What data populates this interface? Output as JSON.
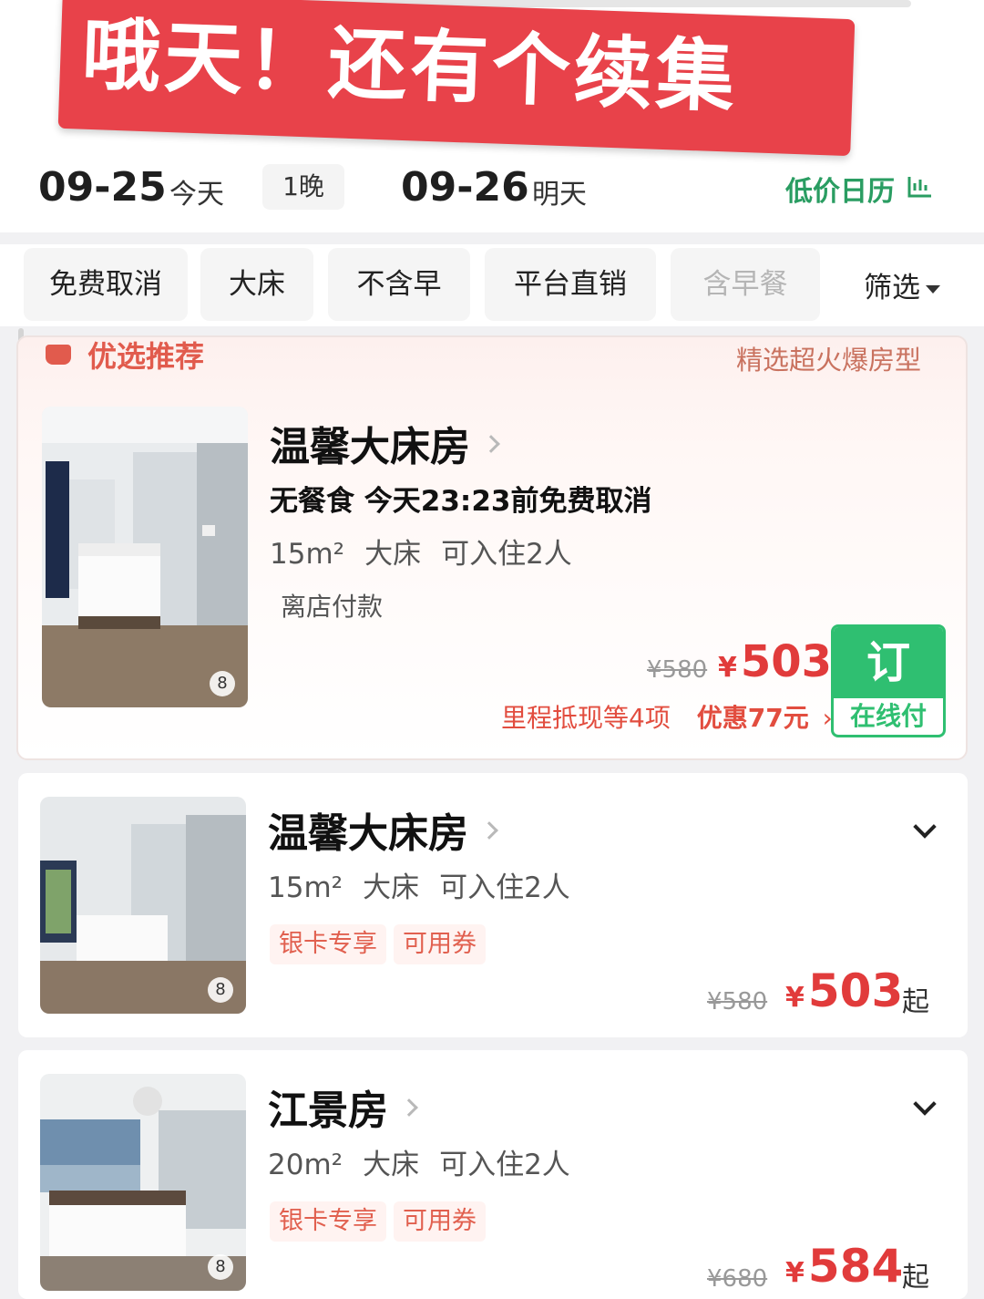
{
  "banner": {
    "text": "哦天！还有个续集"
  },
  "dates": {
    "checkin": "09-25",
    "checkin_label": "今天",
    "nights": "1晚",
    "checkout": "09-26",
    "checkout_label": "明天",
    "calendar_link": "低价日历"
  },
  "filters": {
    "chips": [
      "免费取消",
      "大床",
      "不含早",
      "平台直销",
      "含早餐"
    ],
    "filter_button": "筛选"
  },
  "featured": {
    "header": "优选推荐",
    "subheader": "精选超火爆房型",
    "room": {
      "title": "温馨大床房",
      "meal_cancel": "无餐食  今天23:23前免费取消",
      "size": "15m²",
      "bed": "大床",
      "capacity": "可入住2人",
      "payment_note": "离店付款",
      "photo_count": "8",
      "original_price": "¥580",
      "currency": "¥",
      "price": "503",
      "promo_items": "里程抵现等4项",
      "promo_discount": "优惠77元",
      "book_label": "订",
      "book_sublabel": "在线付"
    }
  },
  "rooms": [
    {
      "title": "温馨大床房",
      "size": "15m²",
      "bed": "大床",
      "capacity": "可入住2人",
      "tags": [
        "银卡专享",
        "可用券"
      ],
      "photo_count": "8",
      "original_price": "¥580",
      "currency": "¥",
      "price": "503",
      "price_suffix": "起"
    },
    {
      "title": "江景房",
      "size": "20m²",
      "bed": "大床",
      "capacity": "可入住2人",
      "tags": [
        "银卡专享",
        "可用券"
      ],
      "photo_count": "8",
      "original_price": "¥680",
      "currency": "¥",
      "price": "584",
      "price_suffix": "起"
    }
  ],
  "colors": {
    "accent_red": "#e13b3b",
    "accent_green": "#2fbf71",
    "banner_red": "#e8424a"
  }
}
